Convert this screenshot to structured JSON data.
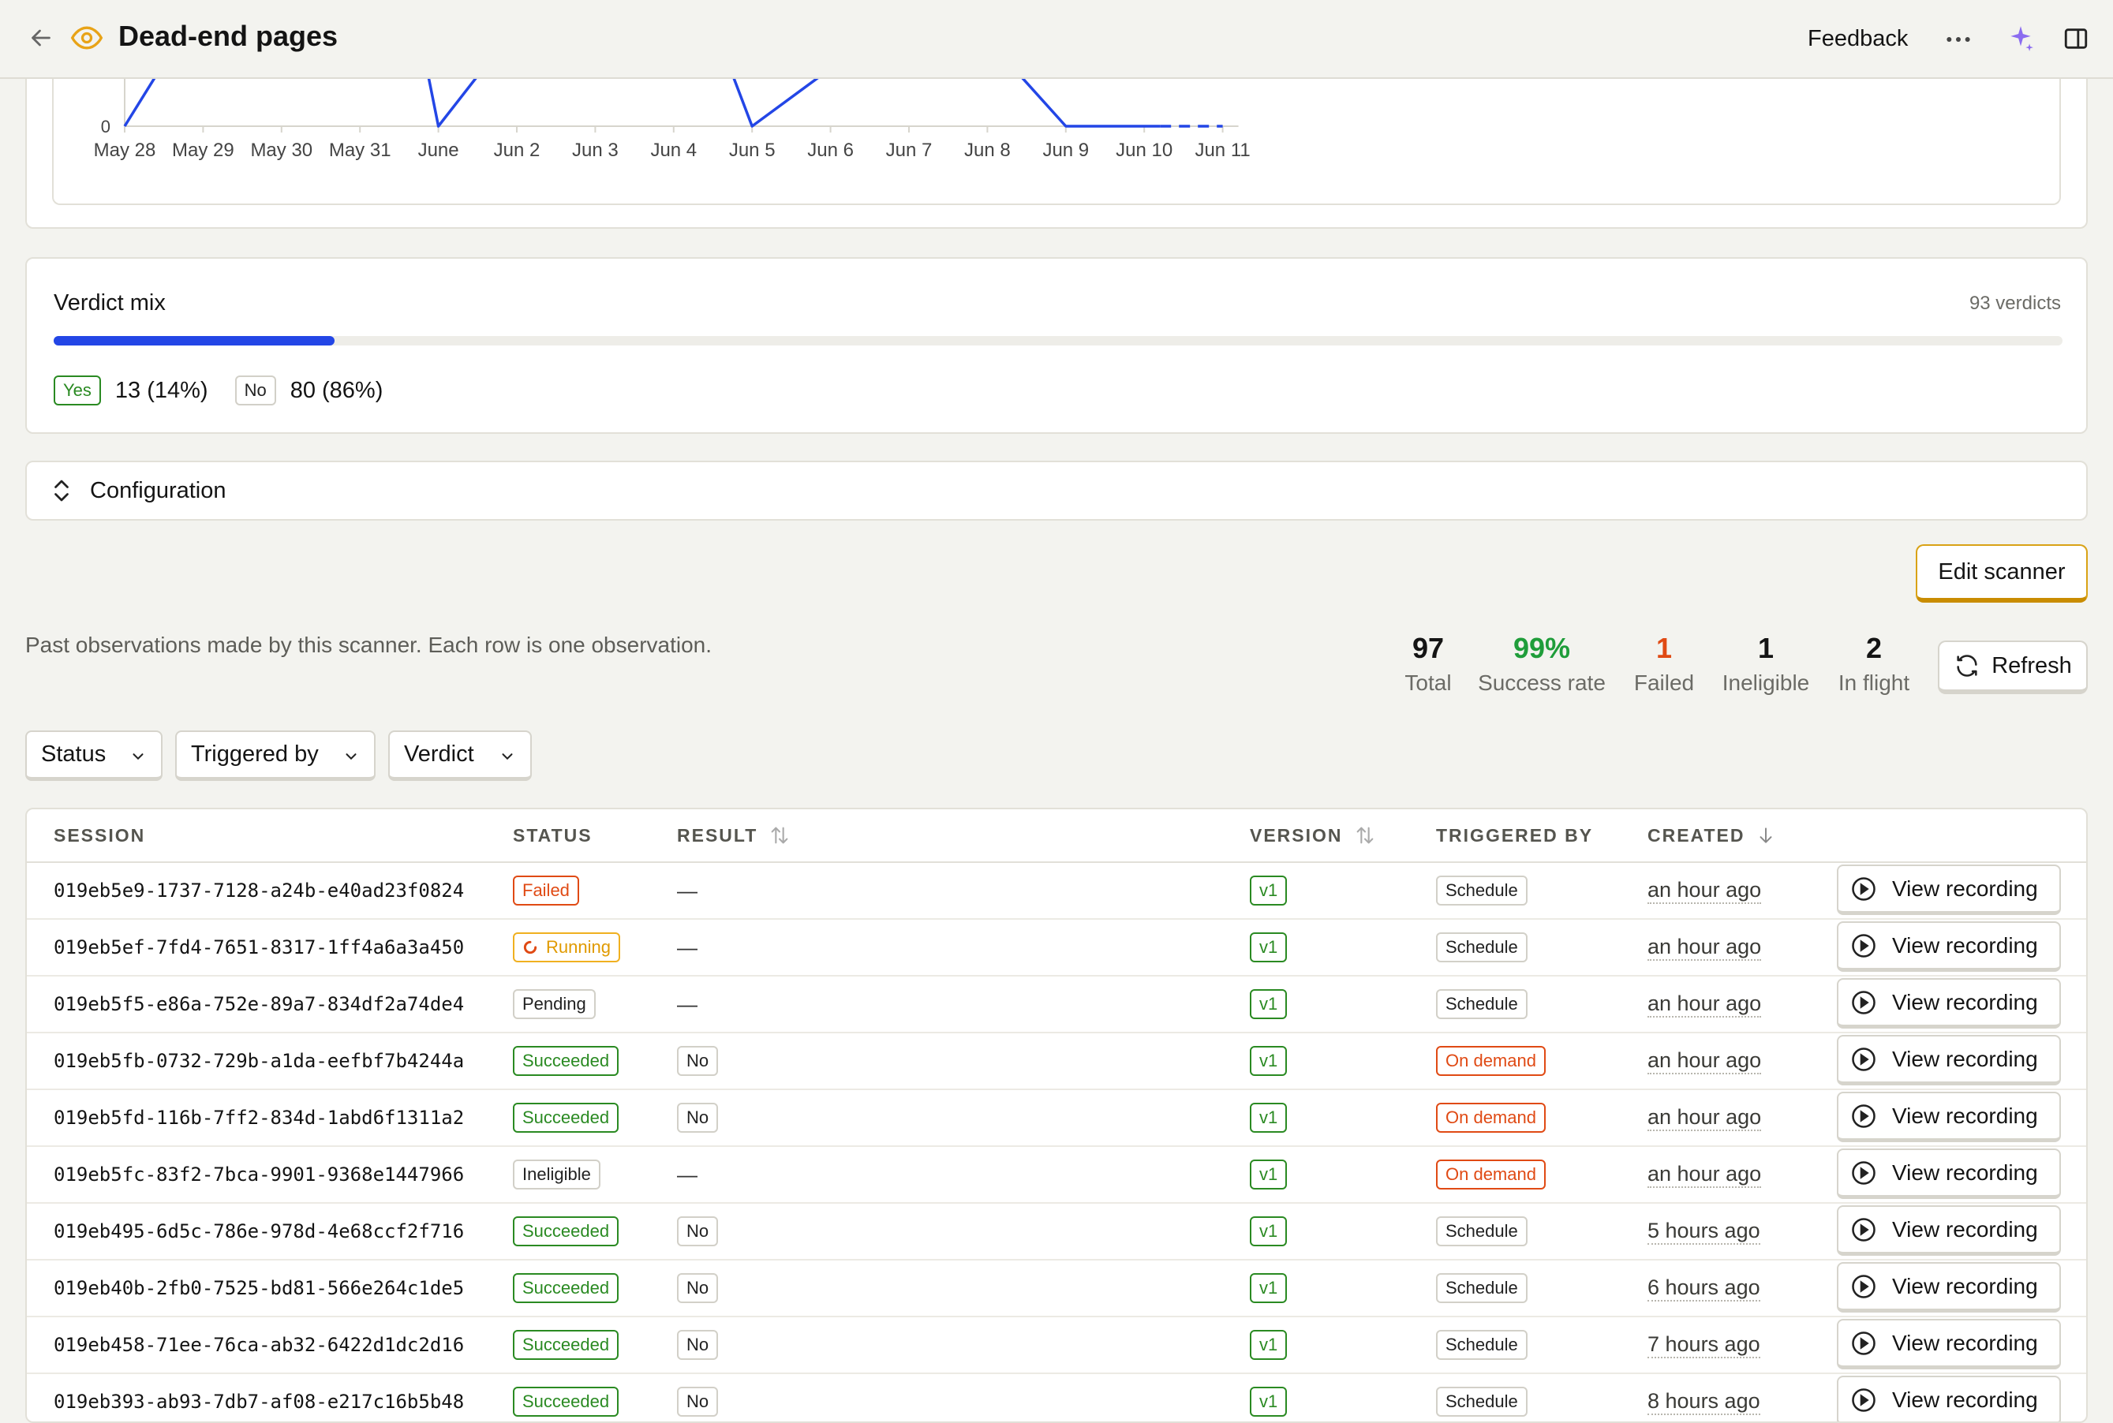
{
  "header": {
    "title": "Dead-end pages",
    "feedback_label": "Feedback"
  },
  "chart_data": {
    "type": "line",
    "x_ticks": [
      "May 28",
      "May 29",
      "May 30",
      "May 31",
      "June",
      "Jun 2",
      "Jun 3",
      "Jun 4",
      "Jun 5",
      "Jun 6",
      "Jun 7",
      "Jun 8",
      "Jun 9",
      "Jun 10",
      "Jun 11"
    ],
    "y_tick_visible": "0",
    "series": [
      {
        "points_visible": [
          {
            "x": "May 28",
            "y": 0
          },
          {
            "x": "June",
            "y": 0
          },
          {
            "x": "Jun 5",
            "y": 0
          },
          {
            "x": "Jun 9",
            "y": 0
          },
          {
            "x": "Jun 10",
            "y": 0
          },
          {
            "x": "Jun 11",
            "y": 0
          }
        ],
        "projected_from": "Jun 10",
        "color": "#2346e6"
      }
    ]
  },
  "verdict": {
    "title": "Verdict mix",
    "count_label": "93 verdicts",
    "yes_fraction": 0.14,
    "yes_label": "Yes",
    "yes_value": "13 (14%)",
    "no_label": "No",
    "no_value": "80 (86%)"
  },
  "config": {
    "label": "Configuration"
  },
  "actions": {
    "edit_label": "Edit scanner",
    "refresh_label": "Refresh"
  },
  "intro": "Past observations made by this scanner. Each row is one observation.",
  "stats": [
    {
      "value": "97",
      "label": "Total",
      "color": "#141414"
    },
    {
      "value": "99%",
      "label": "Success rate",
      "color": "#1f9d3a"
    },
    {
      "value": "1",
      "label": "Failed",
      "color": "#e04a14"
    },
    {
      "value": "1",
      "label": "Ineligible",
      "color": "#141414"
    },
    {
      "value": "2",
      "label": "In flight",
      "color": "#141414"
    }
  ],
  "filters": [
    "Status",
    "Triggered by",
    "Verdict"
  ],
  "table": {
    "columns": [
      "SESSION",
      "STATUS",
      "RESULT",
      "VERSION",
      "TRIGGERED BY",
      "CREATED"
    ],
    "action_label": "View recording",
    "rows": [
      {
        "session": "019eb5e9-1737-7128-a24b-e40ad23f0824",
        "status": "Failed",
        "status_kind": "failed",
        "result": "—",
        "version": "v1",
        "trigger": "Schedule",
        "trigger_kind": "schedule",
        "created": "an hour ago"
      },
      {
        "session": "019eb5ef-7fd4-7651-8317-1ff4a6a3a450",
        "status": "Running",
        "status_kind": "running",
        "result": "—",
        "version": "v1",
        "trigger": "Schedule",
        "trigger_kind": "schedule",
        "created": "an hour ago"
      },
      {
        "session": "019eb5f5-e86a-752e-89a7-834df2a74de4",
        "status": "Pending",
        "status_kind": "pending",
        "result": "—",
        "version": "v1",
        "trigger": "Schedule",
        "trigger_kind": "schedule",
        "created": "an hour ago"
      },
      {
        "session": "019eb5fb-0732-729b-a1da-eefbf7b4244a",
        "status": "Succeeded",
        "status_kind": "succeeded",
        "result": "No",
        "version": "v1",
        "trigger": "On demand",
        "trigger_kind": "ondemand",
        "created": "an hour ago"
      },
      {
        "session": "019eb5fd-116b-7ff2-834d-1abd6f1311a2",
        "status": "Succeeded",
        "status_kind": "succeeded",
        "result": "No",
        "version": "v1",
        "trigger": "On demand",
        "trigger_kind": "ondemand",
        "created": "an hour ago"
      },
      {
        "session": "019eb5fc-83f2-7bca-9901-9368e1447966",
        "status": "Ineligible",
        "status_kind": "ineligible",
        "result": "—",
        "version": "v1",
        "trigger": "On demand",
        "trigger_kind": "ondemand",
        "created": "an hour ago"
      },
      {
        "session": "019eb495-6d5c-786e-978d-4e68ccf2f716",
        "status": "Succeeded",
        "status_kind": "succeeded",
        "result": "No",
        "version": "v1",
        "trigger": "Schedule",
        "trigger_kind": "schedule",
        "created": "5 hours ago"
      },
      {
        "session": "019eb40b-2fb0-7525-bd81-566e264c1de5",
        "status": "Succeeded",
        "status_kind": "succeeded",
        "result": "No",
        "version": "v1",
        "trigger": "Schedule",
        "trigger_kind": "schedule",
        "created": "6 hours ago"
      },
      {
        "session": "019eb458-71ee-76ca-ab32-6422d1dc2d16",
        "status": "Succeeded",
        "status_kind": "succeeded",
        "result": "No",
        "version": "v1",
        "trigger": "Schedule",
        "trigger_kind": "schedule",
        "created": "7 hours ago"
      },
      {
        "session": "019eb393-ab93-7db7-af08-e217c16b5b48",
        "status": "Succeeded",
        "status_kind": "succeeded",
        "result": "No",
        "version": "v1",
        "trigger": "Schedule",
        "trigger_kind": "schedule",
        "created": "8 hours ago"
      }
    ]
  }
}
